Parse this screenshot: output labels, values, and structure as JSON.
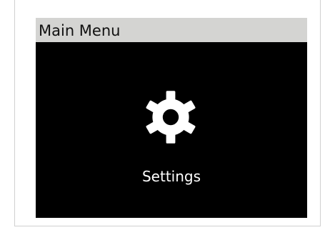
{
  "window": {
    "title": "Main Menu"
  },
  "menu": {
    "current_item": {
      "label": "Settings",
      "icon": "gear-icon"
    }
  },
  "colors": {
    "title_bar_bg": "#d4d4d2",
    "screen_bg": "#000000",
    "icon_color": "#ffffff",
    "label_color": "#ffffff"
  }
}
